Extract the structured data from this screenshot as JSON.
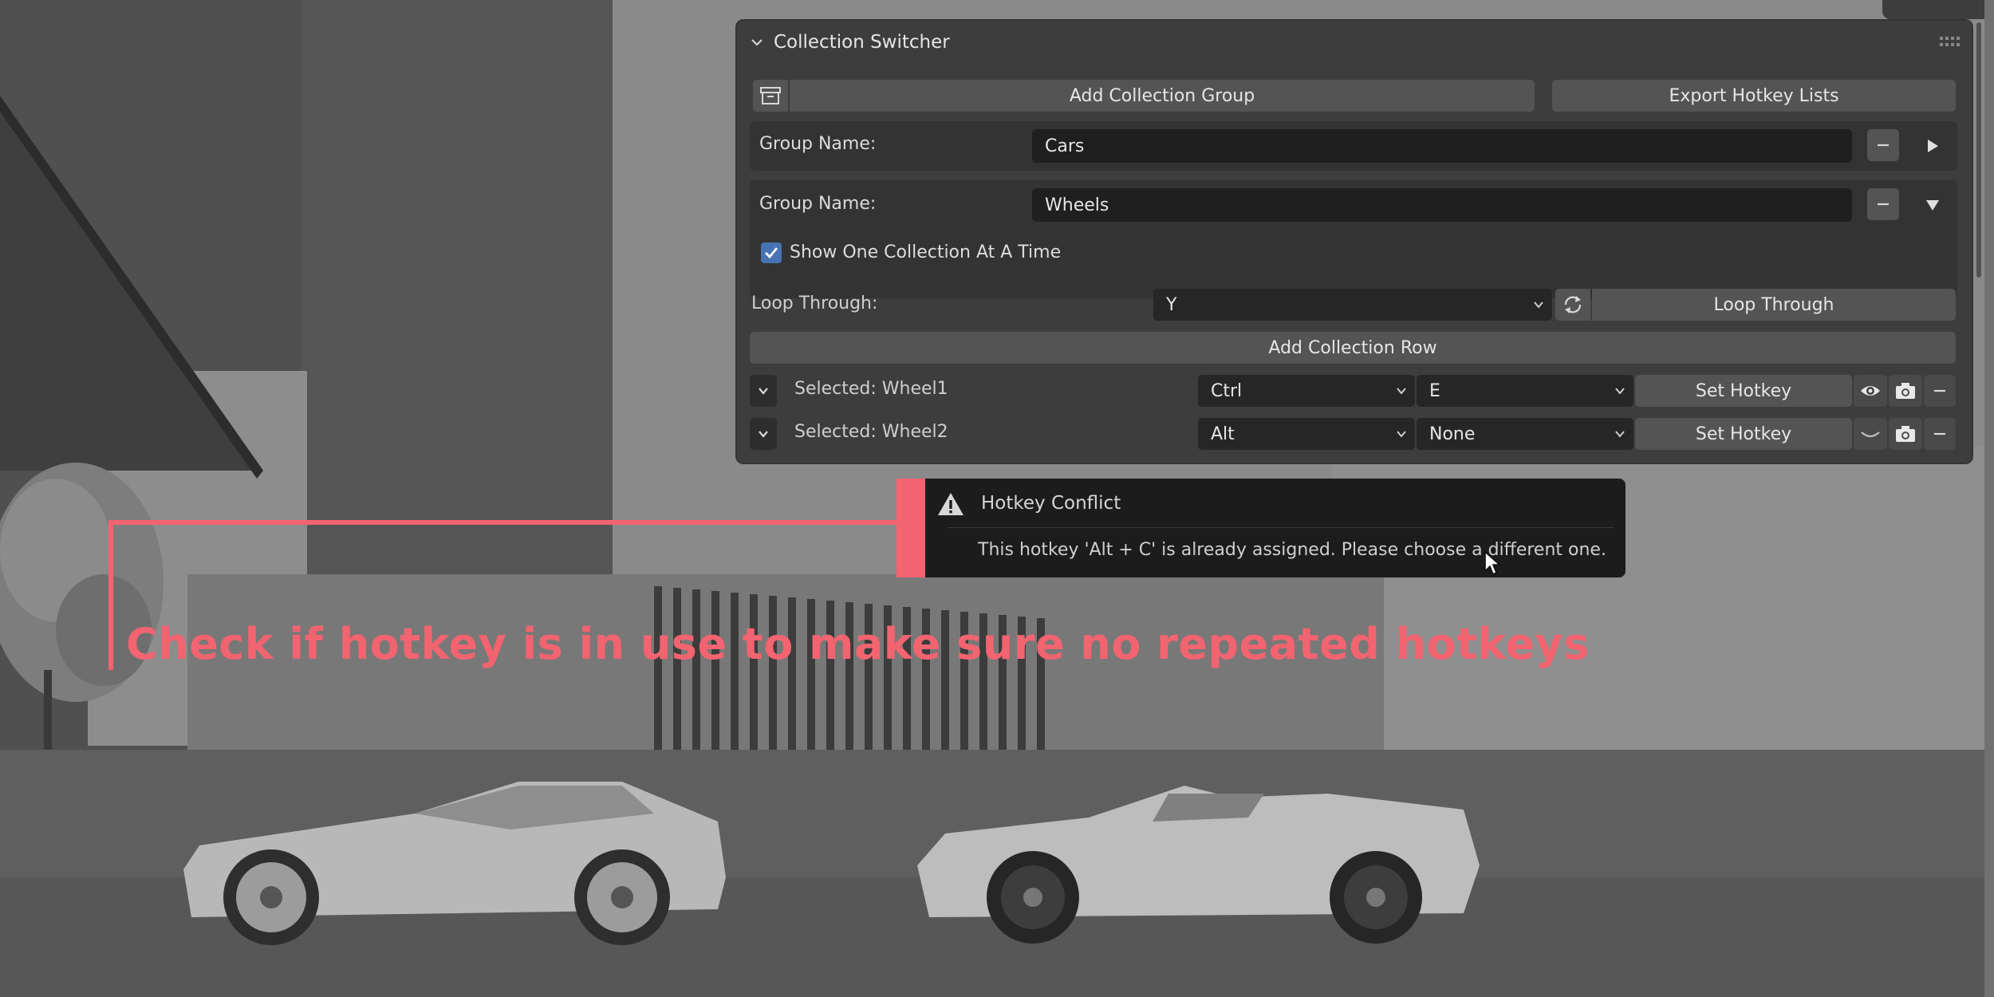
{
  "panel": {
    "title": "Collection Switcher",
    "add_group_label": "Add Collection Group",
    "export_label": "Export Hotkey Lists",
    "groups": [
      {
        "label": "Group Name:",
        "value": "Cars",
        "expanded": false
      },
      {
        "label": "Group Name:",
        "value": "Wheels",
        "expanded": true
      }
    ],
    "show_one_label": "Show One Collection At A Time",
    "show_one_checked": true,
    "loop_label": "Loop Through:",
    "loop_value": "Y",
    "loop_button": "Loop Through",
    "add_row_label": "Add Collection Row",
    "rows": [
      {
        "selected": "Selected: Wheel1",
        "modifier": "Ctrl",
        "key": "E",
        "set_label": "Set Hotkey",
        "visible": true
      },
      {
        "selected": "Selected: Wheel2",
        "modifier": "Alt",
        "key": "None",
        "set_label": "Set Hotkey",
        "visible": false
      }
    ]
  },
  "tooltip": {
    "title": "Hotkey Conflict",
    "message": "This hotkey 'Alt + C' is already assigned. Please choose a different one."
  },
  "annotation": "Check if hotkey is in use to make sure no repeated hotkeys",
  "colors": {
    "accent": "#f26470",
    "checkbox": "#4772b3",
    "panel_bg": "#3d3d3d"
  }
}
